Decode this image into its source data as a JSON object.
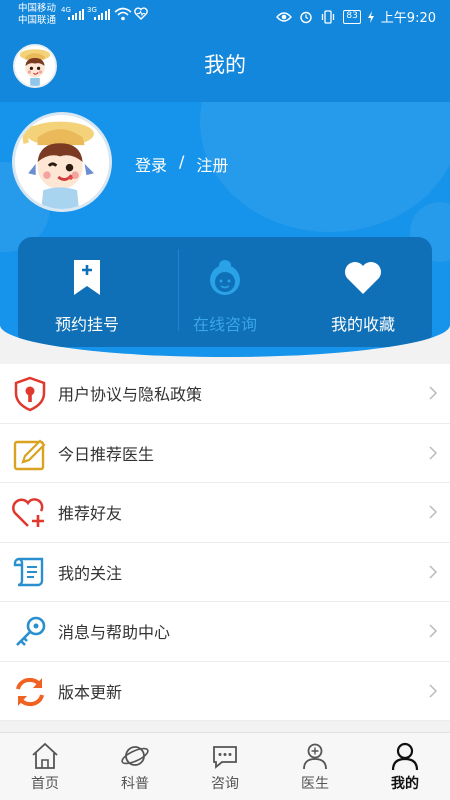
{
  "status_bar": {
    "carrier_1": "中国移动",
    "carrier_2": "中国联通",
    "net_1": "4G",
    "net_2": "3G",
    "battery": "83",
    "time": "上午9:20"
  },
  "header": {
    "title": "我的"
  },
  "auth": {
    "login": "登录",
    "separator": "/",
    "register": "注册"
  },
  "quick_actions": [
    {
      "label": "预约挂号",
      "icon": "bookmark-plus-icon",
      "enabled": true
    },
    {
      "label": "在线咨询",
      "icon": "agent-avatar-icon",
      "enabled": false
    },
    {
      "label": "我的收藏",
      "icon": "heart-icon",
      "enabled": true
    }
  ],
  "menu": [
    {
      "label": "用户协议与隐私政策",
      "icon": "shield-lock-icon"
    },
    {
      "label": "今日推荐医生",
      "icon": "pencil-icon"
    },
    {
      "label": "推荐好友",
      "icon": "heart-plus-icon"
    },
    {
      "label": "我的关注",
      "icon": "scroll-icon"
    },
    {
      "label": "消息与帮助中心",
      "icon": "key-icon"
    },
    {
      "label": "版本更新",
      "icon": "refresh-icon"
    }
  ],
  "tabs": [
    {
      "label": "首页",
      "icon": "home-icon"
    },
    {
      "label": "科普",
      "icon": "planet-icon"
    },
    {
      "label": "咨询",
      "icon": "chat-icon"
    },
    {
      "label": "医生",
      "icon": "doctor-icon"
    },
    {
      "label": "我的",
      "icon": "user-icon",
      "active": true
    }
  ],
  "colors": {
    "primary": "#1387dc",
    "hero": "#1693ea",
    "panel": "#0f6fb7",
    "disabled_label": "#3aa6e8",
    "red": "#e0382e",
    "gold": "#d9a321",
    "teal": "#2a8fcf",
    "orange": "#f16122"
  }
}
